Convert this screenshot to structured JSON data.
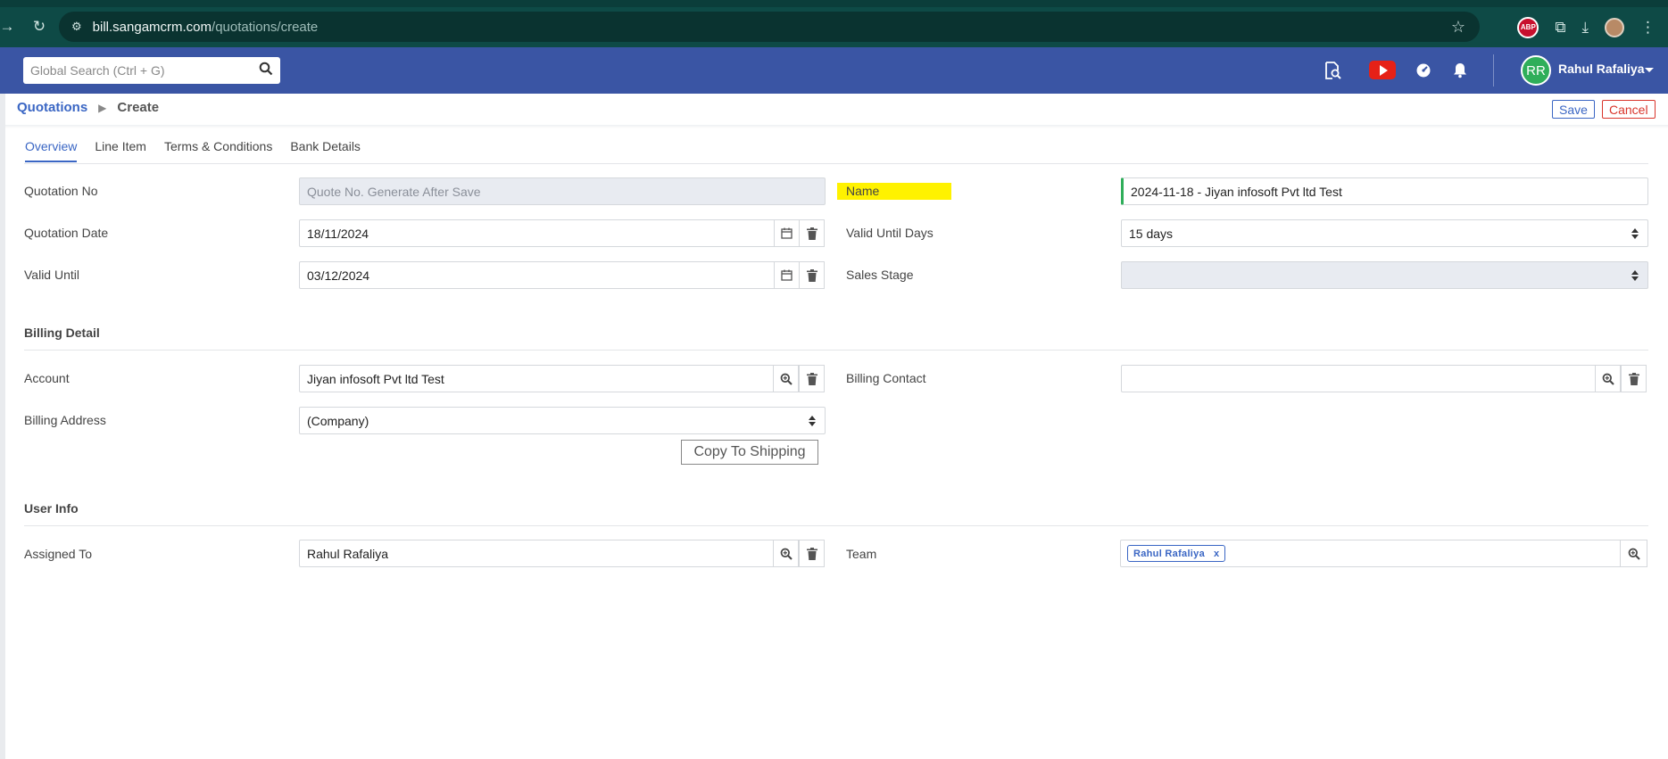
{
  "browser": {
    "url_host": "bill.sangamcrm.com",
    "url_path": "/quotations/create",
    "abp_label": "ABP"
  },
  "header": {
    "search_placeholder": "Global Search (Ctrl + G)",
    "user_initials": "RR",
    "user_name": "Rahul Rafaliya"
  },
  "breadcrumb": {
    "module": "Quotations",
    "current": "Create"
  },
  "actions": {
    "save": "Save",
    "cancel": "Cancel"
  },
  "tabs": [
    {
      "label": "Overview",
      "active": true
    },
    {
      "label": "Line Item",
      "active": false
    },
    {
      "label": "Terms & Conditions",
      "active": false
    },
    {
      "label": "Bank Details",
      "active": false
    }
  ],
  "overview": {
    "quotation_no_label": "Quotation No",
    "quotation_no_placeholder": "Quote No. Generate After Save",
    "name_label": "Name",
    "name_value": "2024-11-18 - Jiyan infosoft Pvt ltd Test",
    "quotation_date_label": "Quotation Date",
    "quotation_date_value": "18/11/2024",
    "valid_until_days_label": "Valid Until Days",
    "valid_until_days_value": "15 days",
    "valid_until_label": "Valid Until",
    "valid_until_value": "03/12/2024",
    "sales_stage_label": "Sales Stage",
    "sales_stage_value": ""
  },
  "billing": {
    "title": "Billing Detail",
    "account_label": "Account",
    "account_value": "Jiyan infosoft Pvt ltd Test",
    "billing_contact_label": "Billing Contact",
    "billing_contact_value": "",
    "billing_address_label": "Billing Address",
    "billing_address_value": "(Company)",
    "copy_button": "Copy To Shipping"
  },
  "user_info": {
    "title": "User Info",
    "assigned_to_label": "Assigned To",
    "assigned_to_value": "Rahul Rafaliya",
    "team_label": "Team",
    "team_tag": "Rahul Rafaliya",
    "team_tag_remove": "x"
  },
  "colors": {
    "header_bg": "#3a55a4",
    "accent": "#3a66c4",
    "cancel": "#d9352b",
    "highlight": "#fff200",
    "avatar": "#2fae5a"
  }
}
